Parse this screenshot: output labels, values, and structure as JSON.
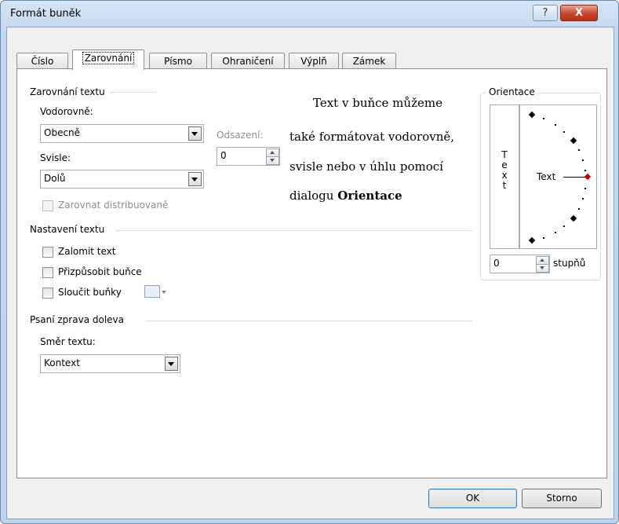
{
  "window": {
    "title": "Formát buněk",
    "help_label": "?",
    "close_label": "X"
  },
  "tabs": [
    {
      "label": "Číslo"
    },
    {
      "label": "Zarovnání"
    },
    {
      "label": "Písmo"
    },
    {
      "label": "Ohraničení"
    },
    {
      "label": "Výplň"
    },
    {
      "label": "Zámek"
    }
  ],
  "active_tab": "Zarovnání",
  "alignment": {
    "group_title": "Zarovnání textu",
    "horizontal_label": "Vodorovně:",
    "horizontal_value": "Obecně",
    "indent_label": "Odsazení:",
    "indent_value": "0",
    "vertical_label": "Svisle:",
    "vertical_value": "Dolů",
    "distributed_label": "Zarovnat distribuovaně"
  },
  "text_control": {
    "group_title": "Nastavení textu",
    "wrap_label": "Zalomit text",
    "shrink_label": "Přizpůsobit buňce",
    "merge_label": "Sloučit buňky"
  },
  "rtl": {
    "group_title": "Psaní zprava doleva",
    "direction_label": "Směr textu:",
    "direction_value": "Kontext"
  },
  "annotation": {
    "line1": "Text v buňce můžeme",
    "line2": "také formátovat vodorovně,",
    "line3": "svisle nebo v úhlu pomocí",
    "line4_prefix": "dialogu",
    "line4_bold": "Orientace"
  },
  "orientation": {
    "group_title": "Orientace",
    "vertical_text": [
      "T",
      "e",
      "x",
      "t"
    ],
    "dial_text": "Text",
    "degrees_value": "0",
    "degrees_label": "stupňů",
    "pointer_color": "#cc0000"
  },
  "footer": {
    "ok_label": "OK",
    "cancel_label": "Storno"
  }
}
